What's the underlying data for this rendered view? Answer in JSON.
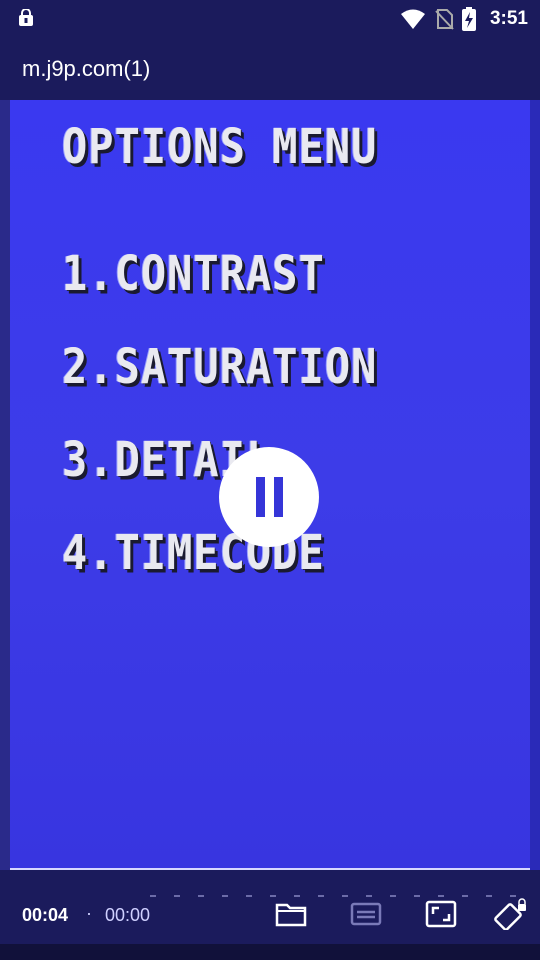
{
  "status_bar": {
    "time": "3:51",
    "icons": [
      "lock-badge-icon",
      "wifi-icon",
      "no-sim-icon",
      "battery-charging-icon"
    ]
  },
  "title_bar": {
    "title": "m.j9p.com(1)"
  },
  "video": {
    "osd_title": "OPTIONS MENU",
    "items": [
      {
        "label": "1.CONTRAST"
      },
      {
        "label": "2.SATURATION"
      },
      {
        "label": "3.DETAIL"
      },
      {
        "label": "4.TIMECODE"
      }
    ],
    "play_state_icon": "pause-icon"
  },
  "controls": {
    "current_time": "00:04",
    "separator": "·",
    "total_time": "00:00",
    "icons": [
      "folder-icon",
      "subtitles-icon",
      "fullscreen-icon",
      "rotate-lock-icon"
    ]
  },
  "colors": {
    "bar_bg": "#1b1b5c",
    "video_bg": "#3a39f0",
    "osd_text": "#e9e9f0"
  }
}
